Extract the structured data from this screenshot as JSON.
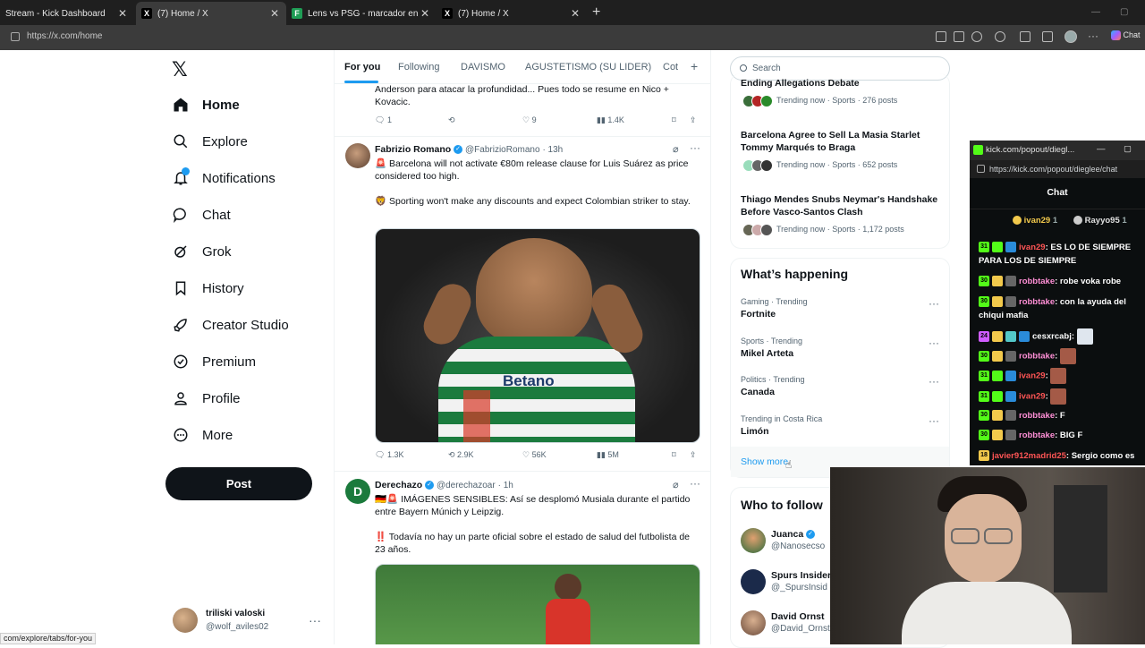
{
  "browser": {
    "tabs": [
      {
        "title": "Stream - Kick Dashboard",
        "active": false
      },
      {
        "title": "(7) Home / X",
        "active": true
      },
      {
        "title": "Lens vs PSG - marcador en vivo, a",
        "active": false
      },
      {
        "title": "(7) Home / X",
        "active": false
      }
    ],
    "url": "https://x.com/home",
    "chat_label": "Chat"
  },
  "nav": {
    "items": [
      {
        "label": "Home",
        "icon": "home-icon"
      },
      {
        "label": "Explore",
        "icon": "search-icon"
      },
      {
        "label": "Notifications",
        "icon": "bell-icon"
      },
      {
        "label": "Chat",
        "icon": "chat-icon"
      },
      {
        "label": "Grok",
        "icon": "grok-icon"
      },
      {
        "label": "History",
        "icon": "bookmark-icon"
      },
      {
        "label": "Creator Studio",
        "icon": "rocket-icon"
      },
      {
        "label": "Premium",
        "icon": "verified-icon"
      },
      {
        "label": "Profile",
        "icon": "person-icon"
      },
      {
        "label": "More",
        "icon": "more-circle-icon"
      }
    ],
    "post_label": "Post",
    "account": {
      "name": "triliski valoski",
      "handle": "@wolf_aviles02"
    }
  },
  "status_url": "com/explore/tabs/for-you",
  "feed": {
    "tabs": [
      "For you",
      "Following",
      "DAVISMO",
      "AGUSTETISMO (SU LIDER)",
      "Cot"
    ],
    "tweet0": {
      "text": "Anderson para atacar la profundidad... Pues todo se resume en Nico + Kovacic.",
      "replies": "1",
      "reposts": "",
      "likes": "9",
      "views": "1.4K"
    },
    "tweet1": {
      "name": "Fabrizio Romano",
      "handle": "@FabrizioRomano",
      "time": "· 13h",
      "line1": "🚨 Barcelona will not activate €80m release clause for Luis Suárez as price considered too high.",
      "line2": "🦁 Sporting won't make any discounts and expect Colombian striker to stay.",
      "replies": "1.3K",
      "reposts": "2.9K",
      "likes": "56K",
      "views": "5M",
      "shirt_text": "Betano"
    },
    "tweet2": {
      "name": "Derechazo",
      "handle": "@derechazoar",
      "time": "· 1h",
      "line1": "🇩🇪🚨 IMÁGENES SENSIBLES: Así se desplomó Musiala durante el partido entre Bayern Múnich y Leipzig.",
      "line2": "‼️ Todavía no hay un parte oficial sobre el estado de salud del futbolista de 23 años."
    }
  },
  "right": {
    "search_placeholder": "Search",
    "news": [
      {
        "title": "Ending Allegations Debate",
        "meta": "Trending now · Sports · 276 posts"
      },
      {
        "title": "Barcelona Agree to Sell La Masia Starlet Tommy Marqués to Braga",
        "meta": "Trending now · Sports · 652 posts"
      },
      {
        "title": "Thiago Mendes Snubs Neymar's Handshake Before Vasco-Santos Clash",
        "meta": "Trending now · Sports · 1,172 posts"
      }
    ],
    "happening_title": "What’s happening",
    "trends": [
      {
        "cat": "Gaming · Trending",
        "name": "Fortnite"
      },
      {
        "cat": "Sports · Trending",
        "name": "Mikel Arteta"
      },
      {
        "cat": "Politics · Trending",
        "name": "Canada"
      },
      {
        "cat": "Trending in Costa Rica",
        "name": "Limón"
      }
    ],
    "show_more": "Show more",
    "wtf_title": "Who to follow",
    "wtf": [
      {
        "name": "Juanca",
        "handle": "@Nanosecso"
      },
      {
        "name": "Spurs Insider",
        "handle": "@_SpursInsid"
      },
      {
        "name": "David Ornst",
        "handle": "@David_Ornst"
      }
    ]
  },
  "kick": {
    "window_title": "kick.com/popout/diegl...",
    "url": "https://kick.com/popout/dieglee/chat",
    "chat_title": "Chat",
    "top_users": [
      {
        "name": "ivan29",
        "count": "1"
      },
      {
        "name": "Rayyo95",
        "count": "1"
      }
    ],
    "messages": [
      {
        "user": "ivan29",
        "text": ": ES LO DE SIEMPRE PARA LOS DE SIEMPRE",
        "color": "#ff5555"
      },
      {
        "user": "robbtake",
        "text": ": robe voka robe",
        "color": "#ff8fd6"
      },
      {
        "user": "robbtake",
        "text": ": con la ayuda del chiqui mafia",
        "color": "#ff8fd6"
      },
      {
        "user": "cesxrcabj",
        "text": ":",
        "color": "#ffffff"
      },
      {
        "user": "robbtake",
        "text": ":",
        "color": "#ff8fd6"
      },
      {
        "user": "ivan29",
        "text": ":",
        "color": "#ff5555"
      },
      {
        "user": "ivan29",
        "text": ":",
        "color": "#ff5555"
      },
      {
        "user": "robbtake",
        "text": ": F",
        "color": "#ff8fd6"
      },
      {
        "user": "robbtake",
        "text": ": BIG F",
        "color": "#ff8fd6"
      },
      {
        "user": "javier912madrid25",
        "text": ": Sergio como es",
        "color": "#ff5555"
      }
    ]
  },
  "colors": {
    "accent": "#1d9bf0",
    "kick_green": "#53fc18"
  }
}
